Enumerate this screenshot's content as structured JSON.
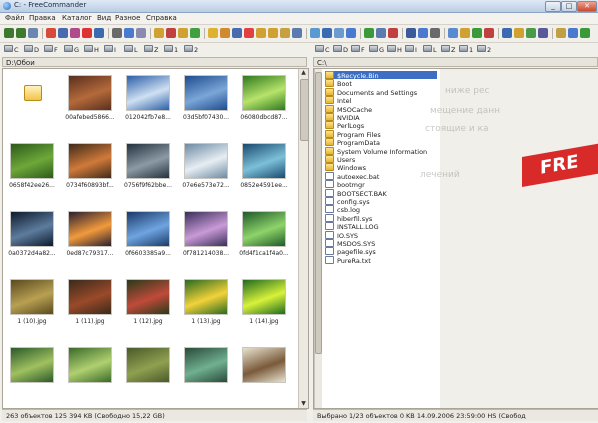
{
  "window": {
    "title": "C: - FreeCommander"
  },
  "window_buttons": [
    "_",
    "□",
    "✕"
  ],
  "menu": [
    "Файл",
    "Правка",
    "Каталог",
    "Вид",
    "Разное",
    "Справка"
  ],
  "left_drives": [
    "C",
    "D",
    "F",
    "G",
    "H",
    "I",
    "L",
    "Z",
    "1",
    "2"
  ],
  "right_drives": [
    "C",
    "D",
    "F",
    "G",
    "H",
    "I",
    "L",
    "Z",
    "1",
    "2"
  ],
  "left_panel": {
    "path": "D:\\Обои",
    "thumbnails": [
      {
        "caption": "",
        "colors": [
          "#fff2c0",
          "#f3c34a"
        ]
      },
      {
        "caption": "00afebed5866...",
        "colors": [
          "#5a2f1e",
          "#b46a3a"
        ]
      },
      {
        "caption": "012042fb7e8...",
        "colors": [
          "#2c5fa8",
          "#cfe0f2"
        ]
      },
      {
        "caption": "03d5bf07430...",
        "colors": [
          "#1f4c8f",
          "#7aa6d8"
        ]
      },
      {
        "caption": "06080dbcd87...",
        "colors": [
          "#2f7a1f",
          "#b7e36b"
        ]
      },
      {
        "caption": "0658f42ee26...",
        "colors": [
          "#2d5a1a",
          "#6ea839"
        ]
      },
      {
        "caption": "0734f60893bf...",
        "colors": [
          "#3f2a1a",
          "#d07a3a"
        ]
      },
      {
        "caption": "0756f9f62bbe...",
        "colors": [
          "#23303d",
          "#8c9aa6"
        ]
      },
      {
        "caption": "07e6e573e72...",
        "colors": [
          "#6c8aa3",
          "#e7eef3"
        ]
      },
      {
        "caption": "0852e4591ee...",
        "colors": [
          "#1a4a6f",
          "#7cc0d8"
        ]
      },
      {
        "caption": "0a0372d4a82...",
        "colors": [
          "#0d1a2c",
          "#5d7c9d"
        ]
      },
      {
        "caption": "0ed87c79317...",
        "colors": [
          "#2a1f2f",
          "#f29a3c"
        ]
      },
      {
        "caption": "0f6603385a9...",
        "colors": [
          "#1a3a6a",
          "#6fa4e0"
        ]
      },
      {
        "caption": "0f781214038...",
        "colors": [
          "#3a2f5a",
          "#c99ad6"
        ]
      },
      {
        "caption": "0fd4f1ca1f4a0...",
        "colors": [
          "#1f5a2a",
          "#8ed36a"
        ]
      },
      {
        "caption": "1 (10).jpg",
        "colors": [
          "#5a4a1f",
          "#b8a052"
        ]
      },
      {
        "caption": "1 (11).jpg",
        "colors": [
          "#3a2a1a",
          "#9a4a2a"
        ]
      },
      {
        "caption": "1 (12).jpg",
        "colors": [
          "#2a3a1a",
          "#c04a3a"
        ]
      },
      {
        "caption": "1 (13).jpg",
        "colors": [
          "#2a6a1f",
          "#f2d23a"
        ]
      },
      {
        "caption": "1 (14).jpg",
        "colors": [
          "#1f6a1f",
          "#d8f23a"
        ]
      },
      {
        "caption": "",
        "colors": [
          "#2a5a2a",
          "#a0c060"
        ]
      },
      {
        "caption": "",
        "colors": [
          "#3a6a2a",
          "#b0d070"
        ]
      },
      {
        "caption": "",
        "colors": [
          "#4a5a2a",
          "#90a050"
        ]
      },
      {
        "caption": "",
        "colors": [
          "#2a4a3a",
          "#70b090"
        ]
      },
      {
        "caption": "",
        "colors": [
          "#e8e2d0",
          "#7a5a3a"
        ]
      }
    ]
  },
  "right_panel": {
    "path": "C:\\",
    "items": [
      {
        "name": "$Recycle.Bin",
        "kind": "folder"
      },
      {
        "name": "Boot",
        "kind": "folder"
      },
      {
        "name": "Documents and Settings",
        "kind": "folder"
      },
      {
        "name": "Intel",
        "kind": "folder"
      },
      {
        "name": "MSOCache",
        "kind": "folder"
      },
      {
        "name": "NVIDIA",
        "kind": "folder"
      },
      {
        "name": "PerlLogs",
        "kind": "folder"
      },
      {
        "name": "Program Files",
        "kind": "folder"
      },
      {
        "name": "ProgramData",
        "kind": "folder"
      },
      {
        "name": "System Volume Information",
        "kind": "folder"
      },
      {
        "name": "Users",
        "kind": "folder"
      },
      {
        "name": "Windows",
        "kind": "folder"
      },
      {
        "name": "autoexec.bat",
        "kind": "file"
      },
      {
        "name": "bootmgr",
        "kind": "file"
      },
      {
        "name": "BOOTSECT.BAK",
        "kind": "file"
      },
      {
        "name": "config.sys",
        "kind": "file"
      },
      {
        "name": "csb.log",
        "kind": "file"
      },
      {
        "name": "hiberfil.sys",
        "kind": "file"
      },
      {
        "name": "INSTALL.LOG",
        "kind": "file"
      },
      {
        "name": "IO.SYS",
        "kind": "file"
      },
      {
        "name": "MSDOS.SYS",
        "kind": "file"
      },
      {
        "name": "pagefile.sys",
        "kind": "file"
      },
      {
        "name": "PureRa.txt",
        "kind": "file"
      }
    ]
  },
  "status": {
    "left": "263 объектов  125 394 KB  (Свободно 15,22 GB)",
    "right": "Выбрано 1/23 объектов  0 KB  14.09.2006 23:59:00  HS  (Свобод"
  },
  "background": {
    "promo_text": "FRE",
    "ghost_lines": [
      "ниже рес",
      "мещение данн",
      "стоящие и ка",
      "лечений"
    ]
  },
  "colors": {
    "accent": "#2a6ab5",
    "selection": "#3d6ec4",
    "promo": "#d92a2a"
  }
}
